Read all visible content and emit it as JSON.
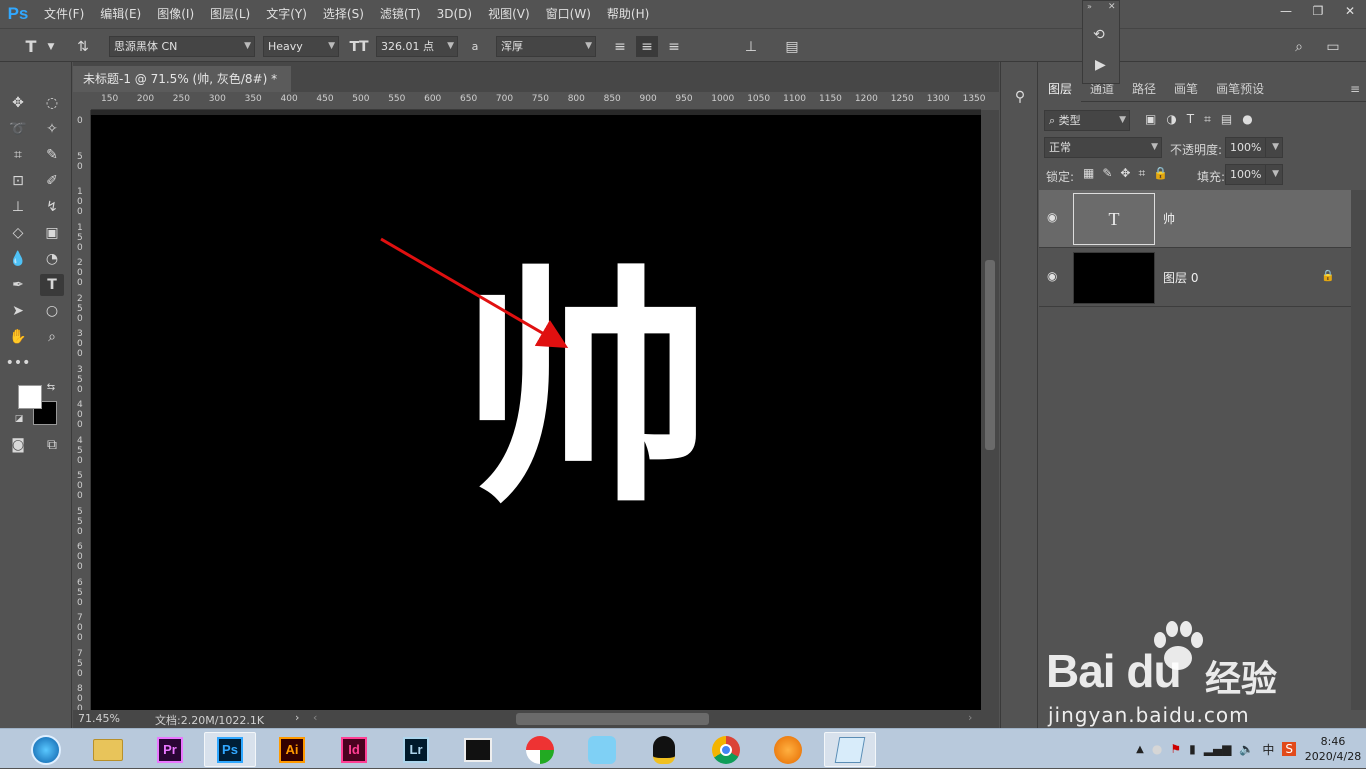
{
  "app": {
    "logo": "Ps",
    "menu": [
      "文件(F)",
      "编辑(E)",
      "图像(I)",
      "图层(L)",
      "文字(Y)",
      "选择(S)",
      "滤镜(T)",
      "3D(D)",
      "视图(V)",
      "窗口(W)",
      "帮助(H)"
    ]
  },
  "options": {
    "font_family": "思源黑体 CN",
    "font_style": "Heavy",
    "font_size": "326.01 点",
    "aa_icon_text": "a",
    "antialias": "浑厚",
    "text_color": "#ffffff"
  },
  "document": {
    "tab_title": "未标题-1 @ 71.5% (帅, 灰色/8#) *",
    "canvas_text": "帅",
    "canvas_text_color": "#ffffff",
    "canvas_bg": "#000000",
    "ruler_h": [
      "150",
      "200",
      "250",
      "300",
      "350",
      "400",
      "450",
      "500",
      "550",
      "600",
      "650",
      "700",
      "750",
      "800",
      "850",
      "900",
      "950",
      "1000",
      "1050",
      "1100",
      "1150",
      "1200",
      "1250",
      "1300",
      "1350"
    ],
    "ruler_v": [
      "0",
      "50",
      "100",
      "150",
      "200",
      "250",
      "300",
      "350",
      "400",
      "450",
      "500",
      "550",
      "600",
      "650",
      "700",
      "750",
      "800"
    ],
    "zoom": "71.45%",
    "doc_info": "文档:2.20M/1022.1K"
  },
  "layers": {
    "tabs": [
      "图层",
      "通道",
      "路径",
      "画笔",
      "画笔预设"
    ],
    "filter_label": "类型",
    "blend_mode": "正常",
    "opacity_label": "不透明度:",
    "opacity": "100%",
    "lock_label": "锁定:",
    "fill_label": "填充:",
    "fill": "100%",
    "items": [
      {
        "name": "帅",
        "thumb_glyph": "T",
        "selected": true
      },
      {
        "name": "图层 0",
        "thumb_glyph": "",
        "selected": false
      }
    ]
  },
  "taskbar": {
    "apps": [
      {
        "label": "Pr",
        "color": "#ea77ff",
        "bg": "#2a0634"
      },
      {
        "label": "Ps",
        "color": "#31a8ff",
        "bg": "#001e36"
      },
      {
        "label": "Ai",
        "color": "#ff9a00",
        "bg": "#330000"
      },
      {
        "label": "Id",
        "color": "#ff3f94",
        "bg": "#49021f"
      },
      {
        "label": "Lr",
        "color": "#add5ec",
        "bg": "#001a2b"
      }
    ],
    "ime": "中",
    "time": "8:46",
    "date": "2020/4/28"
  },
  "watermark": {
    "logo": "Bai du",
    "jingyan": "经验",
    "url": "jingyan.baidu.com"
  }
}
